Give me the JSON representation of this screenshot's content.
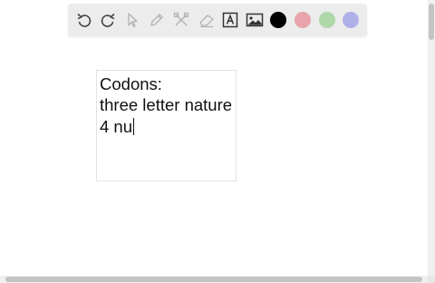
{
  "toolbar": {
    "tools": [
      {
        "name": "undo-icon"
      },
      {
        "name": "redo-icon"
      },
      {
        "name": "select-pointer-icon"
      },
      {
        "name": "pen-icon"
      },
      {
        "name": "tools-icon"
      },
      {
        "name": "eraser-icon"
      },
      {
        "name": "text-tool-icon"
      },
      {
        "name": "image-icon"
      }
    ],
    "colors": [
      "#000000",
      "#e8a3ab",
      "#aed8a9",
      "#b0b0e8"
    ],
    "selected_color": "#000000"
  },
  "note": {
    "lines": [
      "Codons:",
      "three letter nature",
      "4 nu"
    ]
  }
}
